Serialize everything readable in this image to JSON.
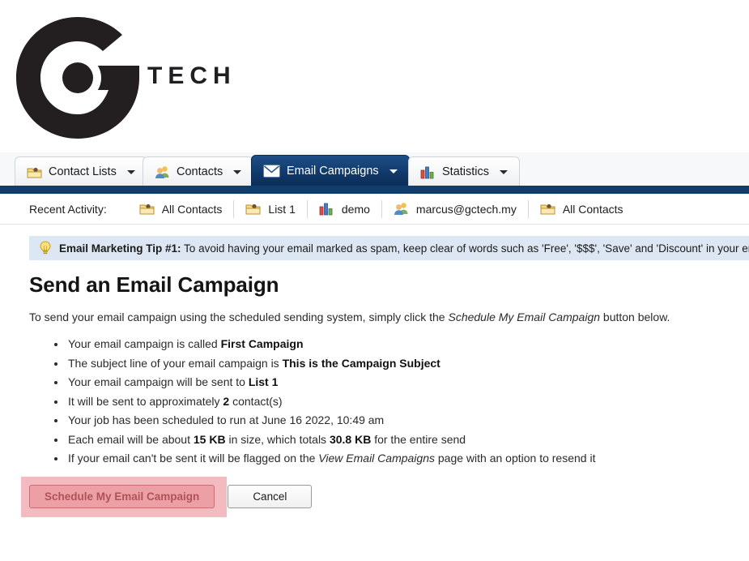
{
  "brand": {
    "logo_icon": "gtech-g-logo",
    "wordmark": "TECH"
  },
  "tabs": [
    {
      "label": "Contact Lists",
      "icon": "contact-list-folder-icon",
      "active": false
    },
    {
      "label": "Contacts",
      "icon": "contacts-people-icon",
      "active": false
    },
    {
      "label": "Email Campaigns",
      "icon": "envelope-icon",
      "active": true
    },
    {
      "label": "Statistics",
      "icon": "bar-chart-icon",
      "active": false
    }
  ],
  "recent_activity": {
    "label": "Recent Activity:",
    "items": [
      {
        "label": "All Contacts",
        "icon": "contact-list-folder-icon"
      },
      {
        "label": "List 1",
        "icon": "contact-list-folder-icon"
      },
      {
        "label": "demo",
        "icon": "bar-chart-icon"
      },
      {
        "label": "marcus@gctech.my",
        "icon": "contacts-people-icon"
      },
      {
        "label": "All Contacts",
        "icon": "contact-list-folder-icon"
      }
    ]
  },
  "tip_banner": {
    "icon": "lightbulb-icon",
    "title": "Email Marketing Tip #1:",
    "body": " To avoid having your email marked as spam, keep clear of words such as 'Free', '$$$', 'Save' and 'Discount' in your email"
  },
  "main": {
    "title": "Send an Email Campaign",
    "intro_before": "To send your email campaign using the scheduled sending system, simply click the ",
    "intro_emphasis": "Schedule My Email Campaign",
    "intro_after": " button below.",
    "summary": [
      {
        "before": "Your email campaign is called ",
        "bold": "First Campaign",
        "after": ""
      },
      {
        "before": "The subject line of your email campaign is ",
        "bold": "This is the Campaign Subject",
        "after": ""
      },
      {
        "before": "Your email campaign will be sent to ",
        "bold": "List 1",
        "after": ""
      },
      {
        "before": "It will be sent to approximately ",
        "bold": "2",
        "after": " contact(s)"
      },
      {
        "before": "Your job has been scheduled to run at June 16 2022, 10:49 am",
        "bold": "",
        "after": ""
      },
      {
        "before": "Each email will be about ",
        "bold": "15 KB",
        "mid": " in size, which totals ",
        "bold2": "30.8 KB",
        "after": " for the entire send"
      },
      {
        "before": "If your email can't be sent it will be flagged on the ",
        "italic": "View Email Campaigns",
        "after": " page with an option to resend it"
      }
    ]
  },
  "actions": {
    "submit_label": "Schedule My Email Campaign",
    "cancel_label": "Cancel",
    "highlight_color": "#e9828b"
  }
}
